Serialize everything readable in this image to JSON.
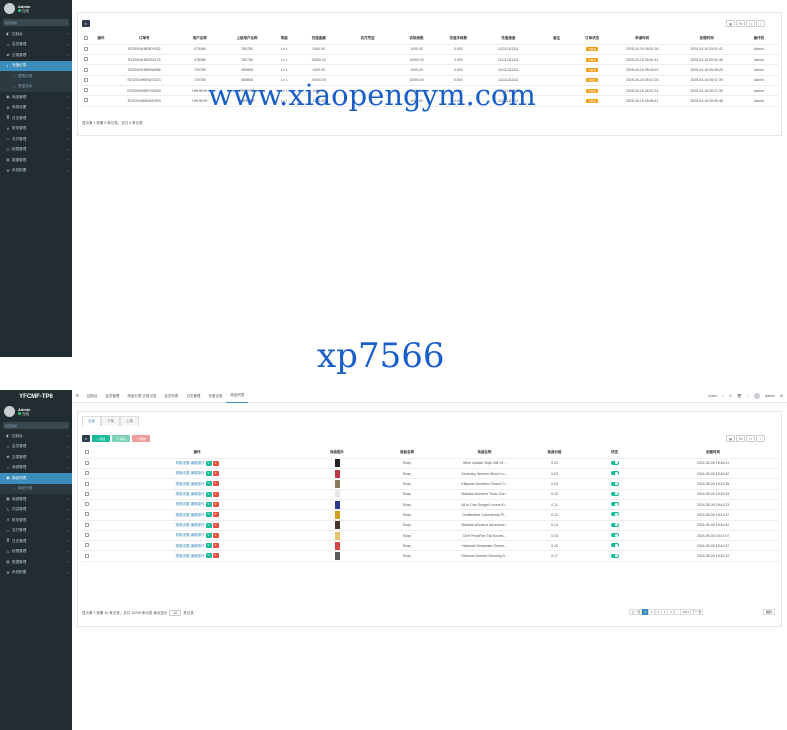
{
  "top": {
    "sidebar": {
      "user": {
        "name": "Admin",
        "status": "在线"
      },
      "search_placeholder": "搜索菜单",
      "items": [
        {
          "label": "控制台",
          "icon": "dashboard-icon",
          "kind": "normal"
        },
        {
          "label": "会员管理",
          "icon": "user-icon",
          "kind": "normal"
        },
        {
          "label": "交易管理",
          "icon": "exchange-icon",
          "kind": "normal"
        },
        {
          "label": "充值记录",
          "icon": "recharge-icon",
          "kind": "active"
        },
        {
          "label": "提现记录",
          "icon": "withdraw-icon",
          "kind": "sub"
        },
        {
          "label": "资金流水",
          "icon": "flow-icon",
          "kind": "sub"
        },
        {
          "label": "商品管理",
          "icon": "goods-icon",
          "kind": "normal"
        },
        {
          "label": "系统设置",
          "icon": "gear-icon",
          "kind": "normal"
        },
        {
          "label": "日志管理",
          "icon": "log-icon",
          "kind": "normal"
        },
        {
          "label": "财务管理",
          "icon": "finance-icon",
          "kind": "normal"
        },
        {
          "label": "支付管理",
          "icon": "pay-icon",
          "kind": "normal"
        },
        {
          "label": "权限管理",
          "icon": "lock-icon",
          "kind": "normal"
        },
        {
          "label": "数据管理",
          "icon": "data-icon",
          "kind": "normal"
        },
        {
          "label": "系统配置",
          "icon": "config-icon",
          "kind": "normal"
        }
      ]
    },
    "table": {
      "headers": [
        "操作",
        "订单号",
        "用户名称",
        "上级用户名称",
        "等级",
        "充值金额",
        "实付凭证",
        "实际到账",
        "充值手续费",
        "充值通道",
        "备注",
        "订单状态",
        "申请时间",
        "处理时间",
        "操作员"
      ],
      "rows": [
        [
          "",
          "R232004H8050Y832",
          "478456",
          "780780",
          "Lv 1",
          "1000.00",
          "",
          "1000.00",
          "0.000",
          "111111111111",
          "",
          "待处理",
          "2025-04-15 05:51:36",
          "2025-04-16 05:51:42",
          "Admin"
        ],
        [
          "",
          "R232004H8S304178",
          "478456",
          "780780",
          "Lv 1",
          "10000.00",
          "",
          "10000.00",
          "0.000",
          "111111111111",
          "",
          "待处理",
          "2025-04-15 05:51:41",
          "2025-04-16 05:51:46",
          "Admin"
        ],
        [
          "",
          "R232004H8RAW958",
          "729789",
          "080808",
          "Lv 1",
          "1000.00",
          "",
          "1000.00",
          "0.000",
          "111111111111",
          "",
          "待处理",
          "2025-04-16 05:49:22",
          "2025-04-16 05:49:29",
          "Admin"
        ],
        [
          "",
          "R232004H8RAY3121",
          "729789",
          "080808",
          "Lv 1",
          "10000.00",
          "",
          "10000.00",
          "0.000",
          "111111111111",
          "",
          "待处理",
          "2025-04-16 05:47:26",
          "2025-04-16 05:47:39",
          "Admin"
        ],
        [
          "",
          "R232004H8RYS3950",
          "HHHHHH",
          "RRRRRR",
          "Lv 1",
          "1000.00",
          "",
          "1000.00",
          "0.000",
          "111111111111",
          "",
          "待处理",
          "2025-04-16 05:47:34",
          "2025-04-16 05:47:39",
          "Admin"
        ],
        [
          "",
          "R232004H8RASHRS",
          "HHHHHH",
          "RRRRRR",
          "Lv 1",
          "1000.00",
          "",
          "1000.00",
          "0.000",
          "111111111111",
          "",
          "待处理",
          "2025-04-16 05:55:41",
          "2025-04-16 05:55:48",
          "Admin"
        ]
      ],
      "footer": "显示第 1 到第 6 条记录，总共 6 条记录"
    },
    "toolbar_icons": [
      "table-icon",
      "columns-icon",
      "export-icon",
      "search-icon"
    ]
  },
  "watermarks": {
    "top": "www.xiaopengym.com",
    "middle": "xp7566"
  },
  "bottom": {
    "brand": "YFCMF-TP6",
    "sidebar": {
      "user": {
        "name": "Admin",
        "status": "在线"
      },
      "search_placeholder": "搜索菜单",
      "items": [
        {
          "label": "控制台",
          "icon": "dashboard-icon",
          "kind": "normal"
        },
        {
          "label": "会员管理",
          "icon": "user-icon",
          "kind": "normal"
        },
        {
          "label": "交易管理",
          "icon": "exchange-icon",
          "kind": "normal"
        },
        {
          "label": "商城管理",
          "icon": "shop-icon",
          "kind": "normal"
        },
        {
          "label": "商品列表",
          "icon": "goods-icon",
          "kind": "active"
        },
        {
          "label": "商品分类",
          "icon": "category-icon",
          "kind": "sub"
        },
        {
          "label": "商城管理",
          "icon": "mall-icon",
          "kind": "normal"
        },
        {
          "label": "内容管理",
          "icon": "content-icon",
          "kind": "normal"
        },
        {
          "label": "财务管理",
          "icon": "finance-icon",
          "kind": "normal"
        },
        {
          "label": "支付管理",
          "icon": "pay-icon",
          "kind": "normal"
        },
        {
          "label": "日志管理",
          "icon": "log-icon",
          "kind": "normal"
        },
        {
          "label": "权限管理",
          "icon": "lock-icon",
          "kind": "normal"
        },
        {
          "label": "数据管理",
          "icon": "data-icon",
          "kind": "normal"
        },
        {
          "label": "系统配置",
          "icon": "config-icon",
          "kind": "normal"
        }
      ]
    },
    "nav_tabs": [
      "控制台",
      "会员管理",
      "商品分类 交易记录",
      "会员列表",
      "日志管理",
      "充值记录",
      "商品列表"
    ],
    "topbar_right": [
      "Index",
      "Admin"
    ],
    "content_tabs": [
      "全部",
      "下架",
      "上架"
    ],
    "action_buttons": [
      {
        "label": "↻",
        "color": "#2c3e50"
      },
      {
        "label": "+ 添加",
        "color": "#18bc9c"
      },
      {
        "label": "✎ 编辑",
        "color": "#7cd1b8"
      },
      {
        "label": "✕ 删除",
        "color": "#f19c9c"
      }
    ],
    "table": {
      "headers": [
        "操作",
        "商品图片",
        "商品名称",
        "商品名称",
        "商品价格",
        "状态",
        "创建时间"
      ],
      "op_labels": [
        "规格设置",
        "编辑操作"
      ],
      "rows": [
        {
          "name": "Ebay",
          "title": "Wine Update Style Gift Of...",
          "price": "0.01",
          "time": "2024-05-06 15:46:41",
          "img": "#222222"
        },
        {
          "name": "Ebay",
          "title": "Kentucky Women Winch Lo...",
          "price": "0.03",
          "time": "2024-05-06 15:46:42",
          "img": "#c0394b"
        },
        {
          "name": "Ebay",
          "title": "Kittyslos Womens Closed O...",
          "price": "0.03",
          "time": "2024-05-06 15:42:35",
          "img": "#8b7a5a"
        },
        {
          "name": "Ebay",
          "title": "Staklias Womens Tunic One...",
          "price": "0.10",
          "time": "2024-05-06 15:42:34",
          "img": "#e8e8ef"
        },
        {
          "name": "Ebay",
          "title": "All In One Gadget Lovers Ki...",
          "price": "0.11",
          "time": "2024-05-06 15:41:23",
          "img": "#2b3a8c"
        },
        {
          "name": "Ebay",
          "title": "Outtlimated Commercial Pl...",
          "price": "0.12",
          "time": "2024-05-06 15:41:37",
          "img": "#d4a017"
        },
        {
          "name": "Ebay",
          "title": "Staklias Womens Adventure...",
          "price": "0.13",
          "time": "2024-05-06 15:40:42",
          "img": "#4a3428"
        },
        {
          "name": "Ebay",
          "title": "Chef PenaFlex Tall Knives...",
          "price": "0.15",
          "time": "2024-05-06 15:41:07",
          "img": "#e9c46a"
        },
        {
          "name": "Ebay",
          "title": "Hallmark Keepsake Ornam...",
          "price": "0.15",
          "time": "2024-05-06 15:41:37",
          "img": "#d64545"
        },
        {
          "name": "Ebay",
          "title": "Ohmoral Women Running D...",
          "price": "0.17",
          "time": "2024-05-06 15:40:12",
          "img": "#5a5a5a"
        }
      ],
      "footer": "显示第 1 到第 10 条记录，总共 10208 条记录 每页显示",
      "page_size": "10",
      "footer_tail": "条记录",
      "pagination": [
        "上一页",
        "1",
        "2",
        "3",
        "4",
        "5",
        "...",
        "1021",
        "下一页"
      ],
      "goto": "跳转"
    }
  }
}
